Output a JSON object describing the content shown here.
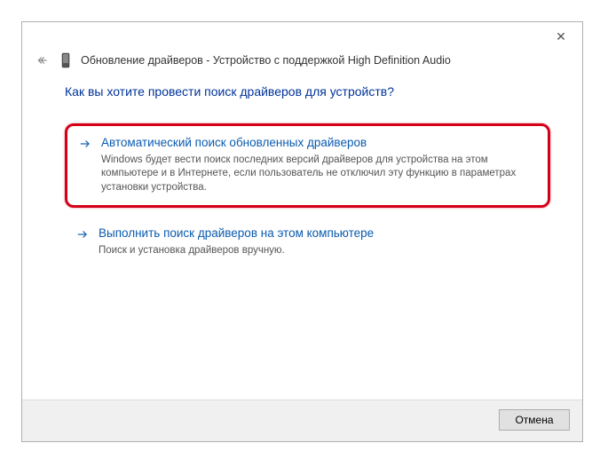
{
  "window": {
    "title": "Обновление драйверов - Устройство с поддержкой High Definition Audio"
  },
  "heading": "Как вы хотите провести поиск драйверов для устройств?",
  "options": [
    {
      "title": "Автоматический поиск обновленных драйверов",
      "desc": "Windows будет вести поиск последних версий драйверов для устройства на этом компьютере и в Интернете, если пользователь не отключил эту функцию в параметрах установки устройства."
    },
    {
      "title": "Выполнить поиск драйверов на этом компьютере",
      "desc": "Поиск и установка драйверов вручную."
    }
  ],
  "buttons": {
    "cancel": "Отмена"
  }
}
